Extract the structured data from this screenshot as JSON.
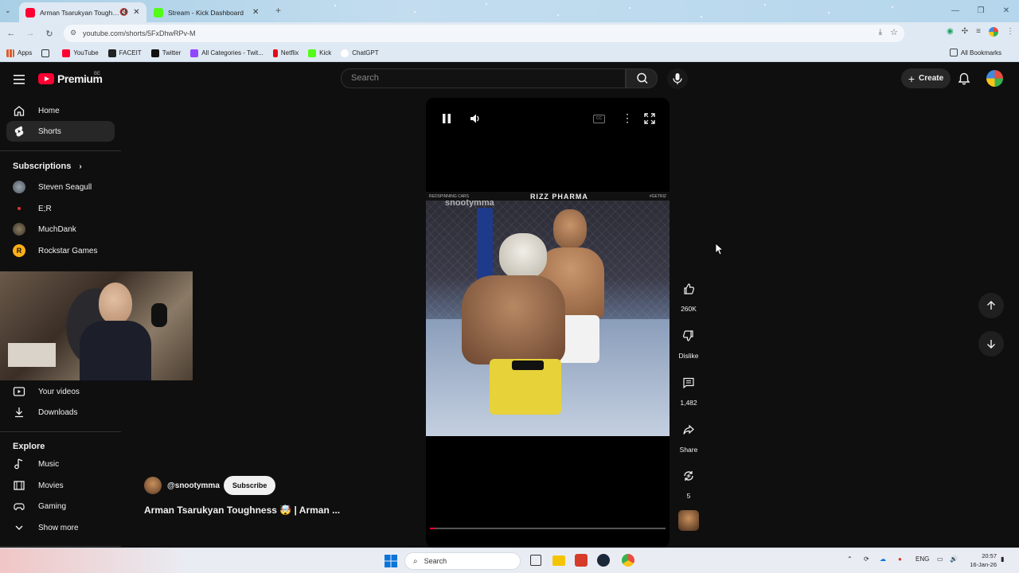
{
  "browser": {
    "tabs": [
      {
        "title": "Arman Tsarukyan Toughness",
        "active": true
      },
      {
        "title": "Stream - Kick Dashboard",
        "active": false
      }
    ],
    "url": "youtube.com/shorts/5FxDhwRPv-M",
    "bookmarks": [
      "Apps",
      "YouTube",
      "FACEIT",
      "Twitter",
      "All Categories - Twit...",
      "Kick",
      "Netflix",
      "Kick",
      "ChatGPT"
    ],
    "all_bookmarks": "All Bookmarks"
  },
  "header": {
    "logo": "Premium",
    "region": "BE",
    "search_placeholder": "Search",
    "create_label": "Create"
  },
  "sidebar": {
    "main": [
      {
        "label": "Home",
        "icon": "home-icon"
      },
      {
        "label": "Shorts",
        "icon": "shorts-icon",
        "selected": true
      }
    ],
    "subscriptions_heading": "Subscriptions",
    "subscriptions": [
      {
        "label": "Steven Seagull",
        "color": "#6e7b88"
      },
      {
        "label": "E;R",
        "color": "#1a1a1a"
      },
      {
        "label": "MuchDank",
        "color": "#5a5040"
      },
      {
        "label": "Rockstar Games",
        "color": "#fcaf17"
      }
    ],
    "you_items": [
      {
        "label": "Your videos",
        "icon": "your-videos-icon"
      },
      {
        "label": "Downloads",
        "icon": "downloads-icon"
      }
    ],
    "explore_heading": "Explore",
    "explore_items": [
      {
        "label": "Music",
        "icon": "music-icon"
      },
      {
        "label": "Movies",
        "icon": "movies-icon"
      },
      {
        "label": "Gaming",
        "icon": "gaming-icon"
      },
      {
        "label": "Show more",
        "icon": "chevron-down-icon"
      }
    ]
  },
  "video": {
    "watermark": "snootymma",
    "banner_text": "RIZZ PHARMA",
    "banner_small_left": "REDSPINNING CARS",
    "banner_small_right": "#GETRIZ",
    "progress": 0.02
  },
  "actions": {
    "likes": "260K",
    "dislike": "Dislike",
    "comments": "1,482",
    "share": "Share",
    "remix": "5"
  },
  "channel": {
    "handle": "@snootymma",
    "subscribe": "Subscribe",
    "title": "Arman Tsarukyan Toughness 🤯 | Arman ..."
  },
  "taskbar": {
    "search": "Search",
    "lang": "ENG",
    "time": "20:57",
    "date": "16-Jan-26"
  },
  "colors": {
    "accent": "#ff0033",
    "background": "#0f0f0f"
  }
}
